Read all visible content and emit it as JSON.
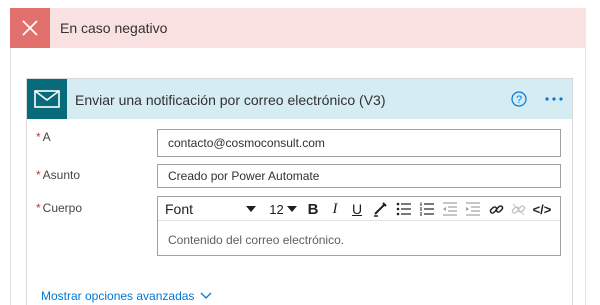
{
  "negative_branch": {
    "title": "En caso negativo",
    "icon": "close-icon",
    "accent_color": "#e2706d",
    "header_bg": "#f9e1e1"
  },
  "action": {
    "title": "Enviar una notificación por correo electrónico (V3)",
    "icon": "mail-icon",
    "header_bg": "#d6ecf3",
    "icon_bg": "#086b7b",
    "help_icon": "help-icon",
    "more_icon": "more-options-icon"
  },
  "fields": {
    "to": {
      "required_mark": "*",
      "label": "A",
      "value": "contacto@cosmoconsult.com"
    },
    "subject": {
      "required_mark": "*",
      "label": "Asunto",
      "value": "Creado por Power Automate"
    },
    "body": {
      "required_mark": "*",
      "label": "Cuerpo",
      "placeholder": "Contenido del correo electrónico."
    }
  },
  "toolbar": {
    "font": "Font",
    "size": "12",
    "bold": "B",
    "italic": "I",
    "underline": "U",
    "code": "</>"
  },
  "advanced": {
    "label": "Mostrar opciones avanzadas",
    "link_color": "#0078d4"
  }
}
